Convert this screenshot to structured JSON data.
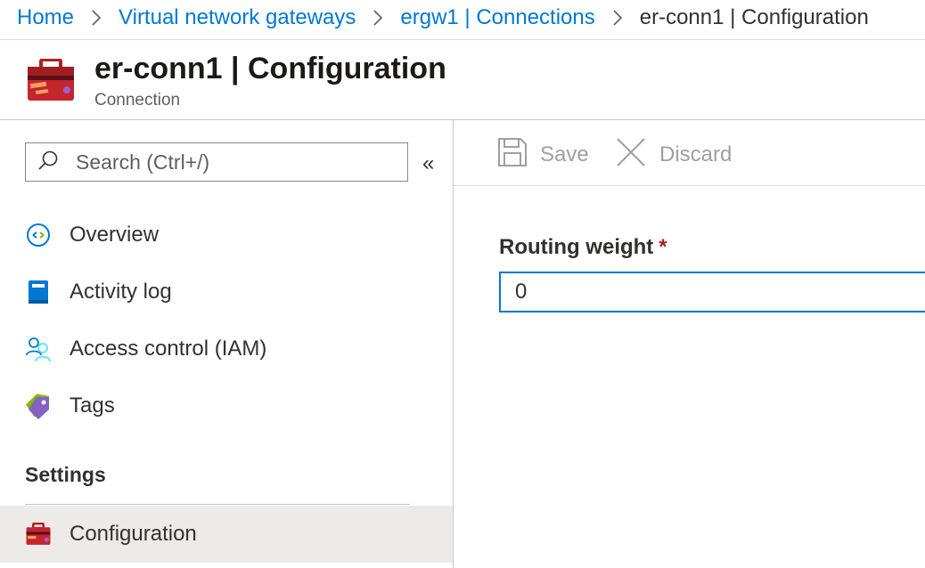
{
  "breadcrumb": {
    "items": [
      "Home",
      "Virtual network gateways",
      "ergw1 | Connections",
      "er-conn1 | Configuration"
    ]
  },
  "header": {
    "title": "er-conn1 | Configuration",
    "subtitle": "Connection",
    "icon": "toolbox-icon"
  },
  "sidebar": {
    "search_placeholder": "Search (Ctrl+/)",
    "collapse_label": "«",
    "items": [
      {
        "label": "Overview",
        "icon": "overview-icon"
      },
      {
        "label": "Activity log",
        "icon": "activity-log-icon"
      },
      {
        "label": "Access control (IAM)",
        "icon": "people-icon"
      },
      {
        "label": "Tags",
        "icon": "tag-icon"
      }
    ],
    "section_label": "Settings",
    "settings_items": [
      {
        "label": "Configuration",
        "icon": "toolbox-icon",
        "active": true
      }
    ]
  },
  "toolbar": {
    "save_label": "Save",
    "discard_label": "Discard",
    "disabled": true
  },
  "form": {
    "routing_weight_label": "Routing weight",
    "required_mark": "*",
    "routing_weight_value": "0"
  },
  "colors": {
    "accent": "#0078d4",
    "required": "#a4262c",
    "active_bg": "#edebe9"
  }
}
